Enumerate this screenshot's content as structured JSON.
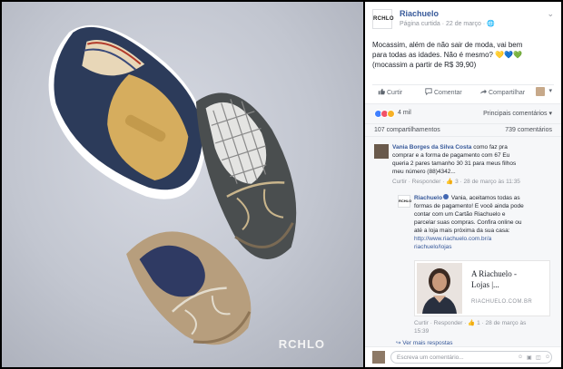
{
  "photo": {
    "watermark": "RCHLO"
  },
  "post": {
    "page_avatar_text": "RCHLO",
    "page_name": "Riachuelo",
    "meta": "Página curtida · 22 de março · 🌐",
    "menu_glyph": "⌄",
    "text_lines": [
      "Mocassim, além de não sair de moda, vai bem",
      "para todas as idades. Não é mesmo?",
      "(mocassim a partir de R$ 39,90)"
    ],
    "hearts": "💛💙💚"
  },
  "actions": {
    "like": "Curtir",
    "comment": "Comentar",
    "share": "Compartilhar",
    "share_menu": "▾"
  },
  "reactions": {
    "count": "4 mil",
    "sort": "Principais comentários ▾"
  },
  "counts": {
    "shares": "107 compartilhamentos",
    "comments": "739 comentários"
  },
  "comment": {
    "author": "Vania Borges da Silva Costa",
    "lines": [
      "como faz pra",
      "comprar e a forma de pagamento com 67 Eu",
      "queria 2 pares tamanho 30 31 para meus filhos",
      "meu número (88)4342..."
    ],
    "meta": "Curtir · Responder · 👍 3 · 28 de março às 11:35"
  },
  "reply": {
    "avatar_text": "RCHLO",
    "author": "Riachuelo",
    "first_line": "Vania, aceitamos todas as",
    "lines": [
      "formas de pagamento! E você ainda pode",
      "contar com um Cartão Riachuelo e",
      "parcelar suas compras. Confira online ou",
      "até a loja mais próxima da sua casa:"
    ],
    "link": "http://www.riachuelo.com.br/a",
    "link2": "riachuelo/lojas",
    "preview": {
      "title_lines": [
        "A Riachuelo -",
        "Lojas |..."
      ],
      "domain": "RIACHUELO.COM.BR"
    },
    "meta_lines": [
      "Curtir · Responder · 👍 1 · 28 de março às",
      "15:39"
    ]
  },
  "more_replies": "↪ Ver mais respostas",
  "composer": {
    "placeholder": "Escreva um comentário...",
    "icons": "☺ ▣ ◫ ☺"
  },
  "colors": {
    "brand_blue": "#365899",
    "link": "#4267b2",
    "panel_bg": "#f6f7f9"
  }
}
